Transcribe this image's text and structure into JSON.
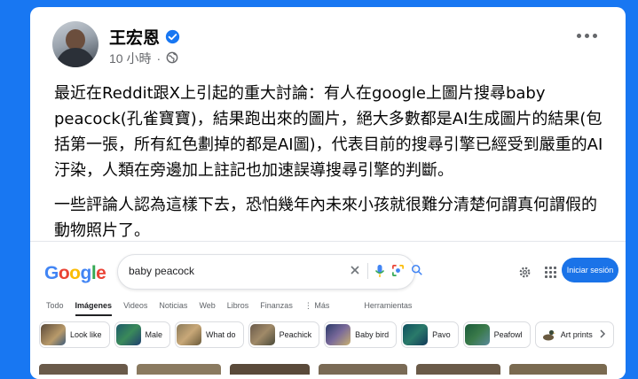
{
  "post": {
    "author": "王宏恩",
    "time": "10 小時",
    "paragraph1": "最近在Reddit跟X上引起的重大討論：有人在google上圖片搜尋baby peacock(孔雀寶寶)，結果跑出來的圖片，絕大多數都是AI生成圖片的結果(包括第一張，所有紅色劃掉的都是AI圖)，代表目前的搜尋引擎已經受到嚴重的AI汙染，人類在旁邊加上註記也加速誤導搜尋引擎的判斷。",
    "paragraph2": "一些評論人認為這樣下去，恐怕幾年內未來小孩就很難分清楚何謂真何謂假的動物照片了。",
    "colors": {
      "verified": "#1877f2",
      "page_bg": "#1877f2"
    }
  },
  "google": {
    "logo": "Google",
    "query": "baby peacock",
    "signin_label": "Iniciar sesión",
    "tabs": [
      "Todo",
      "Imágenes",
      "Videos",
      "Noticias",
      "Web",
      "Libros",
      "Finanzas",
      "⋮ Más",
      "Herramientas"
    ],
    "chips": [
      "Look like",
      "Male",
      "What do",
      "Peachick",
      "Baby bird",
      "Pavo",
      "Peafowl",
      "Art prints"
    ],
    "colors": {
      "signin": "#1a73e8"
    }
  }
}
